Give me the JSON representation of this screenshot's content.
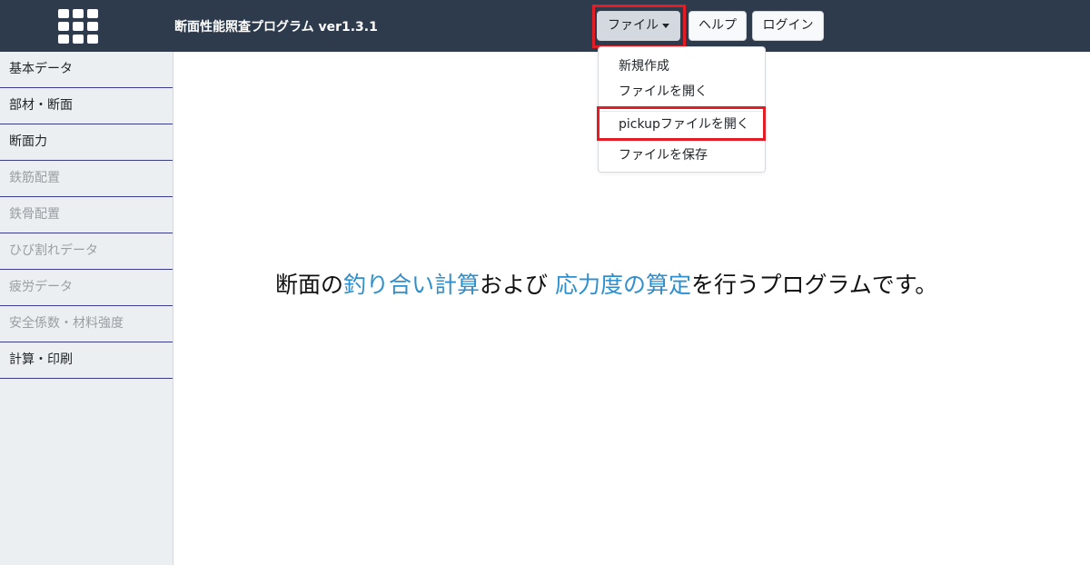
{
  "header": {
    "app_title": "断面性能照査プログラム ver1.3.1",
    "menu_icon": "apps-grid-icon",
    "buttons": {
      "file": "ファイル",
      "help": "ヘルプ",
      "login": "ログイン"
    }
  },
  "file_menu": {
    "items": [
      "新規作成",
      "ファイルを開く",
      "pickupファイルを開く",
      "ファイルを保存"
    ]
  },
  "sidebar": {
    "items": [
      {
        "label": "基本データ",
        "enabled": true
      },
      {
        "label": "部材・断面",
        "enabled": true
      },
      {
        "label": "断面力",
        "enabled": true
      },
      {
        "label": "鉄筋配置",
        "enabled": false
      },
      {
        "label": "鉄骨配置",
        "enabled": false
      },
      {
        "label": "ひび割れデータ",
        "enabled": false
      },
      {
        "label": "疲労データ",
        "enabled": false
      },
      {
        "label": "安全係数・材料強度",
        "enabled": false
      },
      {
        "label": "計算・印刷",
        "enabled": true
      }
    ]
  },
  "main": {
    "headline": {
      "part1": "断面の",
      "accent1": "釣り合い計算",
      "part2": "および ",
      "accent2": "応力度の算定",
      "part3": "を行うプログラムです。"
    }
  },
  "colors": {
    "topbar": "#2d3b4d",
    "accent_text": "#2e8fcf",
    "highlight_box": "#e21d25",
    "sidebar_bg": "#eceff1"
  }
}
